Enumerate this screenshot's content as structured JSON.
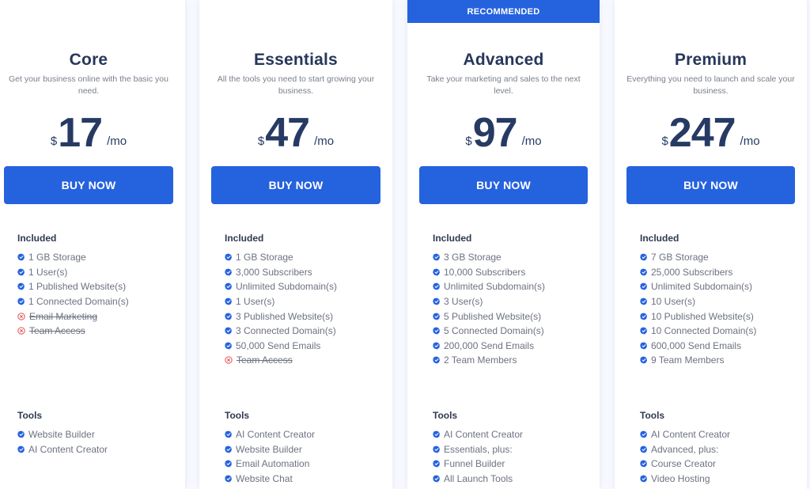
{
  "colors": {
    "accent": "#2562de",
    "heading": "#27375a",
    "excluded": "#e05252"
  },
  "icons": {
    "included": "verified-check-badge-icon",
    "excluded": "x-circle-icon"
  },
  "plans": [
    {
      "name": "Core",
      "description": "Get your business online with the basic you need.",
      "currency": "$",
      "price": "17",
      "period": "/mo",
      "cta": "BUY NOW",
      "included_title": "Included",
      "included": [
        {
          "text": "1 GB Storage",
          "included": true
        },
        {
          "text": "1 User(s)",
          "included": true
        },
        {
          "text": "1 Published Website(s)",
          "included": true
        },
        {
          "text": "1 Connected Domain(s)",
          "included": true
        },
        {
          "text": "Email Marketing",
          "included": false
        },
        {
          "text": "Team Access",
          "included": false
        }
      ],
      "tools_title": "Tools",
      "tools": [
        {
          "text": "Website Builder",
          "included": true
        },
        {
          "text": "AI Content Creator",
          "included": true
        }
      ]
    },
    {
      "name": "Essentials",
      "description": "All the tools you need to start growing your business.",
      "currency": "$",
      "price": "47",
      "period": "/mo",
      "cta": "BUY NOW",
      "included_title": "Included",
      "included": [
        {
          "text": "1 GB Storage",
          "included": true
        },
        {
          "text": "3,000 Subscribers",
          "included": true
        },
        {
          "text": "Unlimited Subdomain(s)",
          "included": true
        },
        {
          "text": "1 User(s)",
          "included": true
        },
        {
          "text": "3 Published Website(s)",
          "included": true
        },
        {
          "text": "3 Connected Domain(s)",
          "included": true
        },
        {
          "text": "50,000 Send Emails",
          "included": true
        },
        {
          "text": "Team Access",
          "included": false
        }
      ],
      "tools_title": "Tools",
      "tools": [
        {
          "text": "AI Content Creator",
          "included": true
        },
        {
          "text": "Website Builder",
          "included": true
        },
        {
          "text": "Email Automation",
          "included": true
        },
        {
          "text": "Website Chat",
          "included": true
        }
      ]
    },
    {
      "badge": "RECOMMENDED",
      "name": "Advanced",
      "description": "Take your marketing and sales to the next level.",
      "currency": "$",
      "price": "97",
      "period": "/mo",
      "cta": "BUY NOW",
      "included_title": "Included",
      "included": [
        {
          "text": "3 GB Storage",
          "included": true
        },
        {
          "text": "10,000 Subscribers",
          "included": true
        },
        {
          "text": "Unlimited Subdomain(s)",
          "included": true
        },
        {
          "text": "3 User(s)",
          "included": true
        },
        {
          "text": "5 Published Website(s)",
          "included": true
        },
        {
          "text": "5 Connected Domain(s)",
          "included": true
        },
        {
          "text": "200,000 Send Emails",
          "included": true
        },
        {
          "text": "2 Team Members",
          "included": true
        }
      ],
      "tools_title": "Tools",
      "tools": [
        {
          "text": "AI Content Creator",
          "included": true
        },
        {
          "text": "Essentials, plus:",
          "included": true
        },
        {
          "text": "Funnel Builder",
          "included": true
        },
        {
          "text": "All Launch Tools",
          "included": true
        }
      ]
    },
    {
      "name": "Premium",
      "description": "Everything you need to launch and scale your business.",
      "currency": "$",
      "price": "247",
      "period": "/mo",
      "cta": "BUY NOW",
      "included_title": "Included",
      "included": [
        {
          "text": "7 GB Storage",
          "included": true
        },
        {
          "text": "25,000 Subscribers",
          "included": true
        },
        {
          "text": "Unlimited Subdomain(s)",
          "included": true
        },
        {
          "text": "10 User(s)",
          "included": true
        },
        {
          "text": "10 Published Website(s)",
          "included": true
        },
        {
          "text": "10 Connected Domain(s)",
          "included": true
        },
        {
          "text": "600,000 Send Emails",
          "included": true
        },
        {
          "text": "9 Team Members",
          "included": true
        }
      ],
      "tools_title": "Tools",
      "tools": [
        {
          "text": "AI Content Creator",
          "included": true
        },
        {
          "text": "Advanced, plus:",
          "included": true
        },
        {
          "text": "Course Creator",
          "included": true
        },
        {
          "text": "Video Hosting",
          "included": true
        }
      ]
    }
  ]
}
